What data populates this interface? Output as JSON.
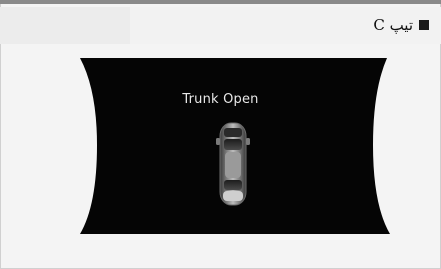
{
  "heading": {
    "text": "تیپ C",
    "bullet_icon": "square-bullet-icon"
  },
  "display": {
    "message": "Trunk Open",
    "vehicle_icon": "car-top-view-icon",
    "trunk_state": "open"
  },
  "colors": {
    "panel_background": "#050505",
    "message_text": "#e8e8e8",
    "page_background": "#f4f4f4"
  }
}
